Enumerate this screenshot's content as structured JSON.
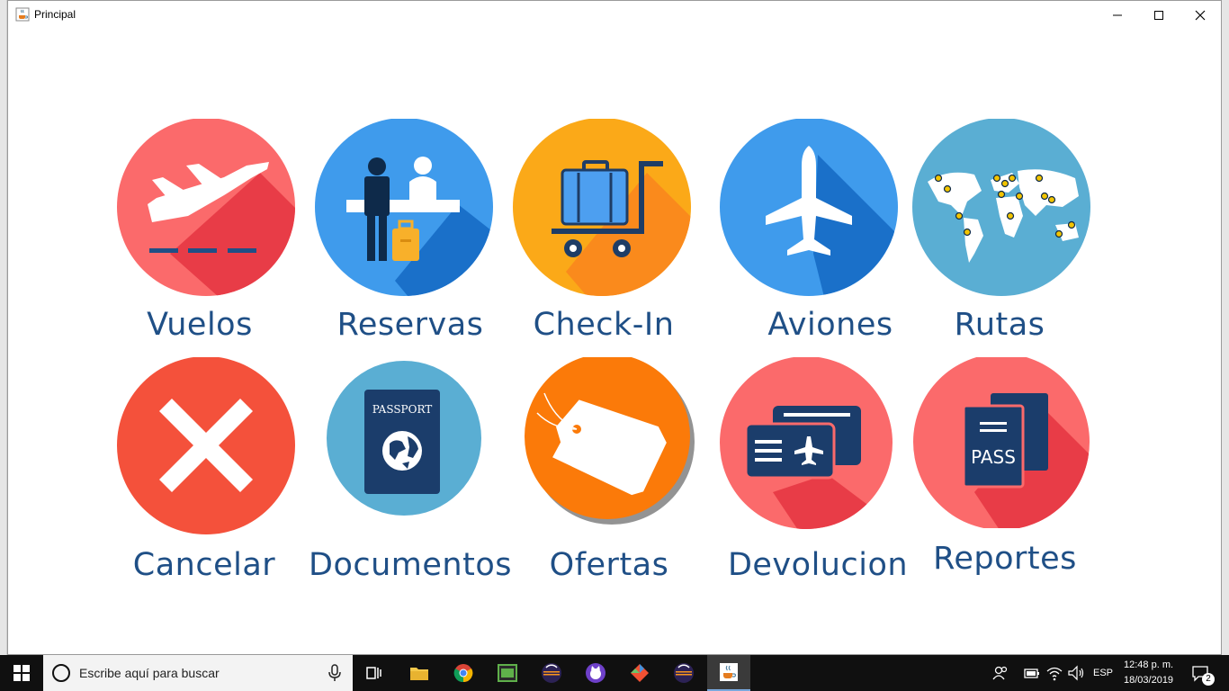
{
  "window": {
    "title": "Principal",
    "icon": "java-cup-icon"
  },
  "tiles": [
    {
      "id": "vuelos",
      "label": "Vuelos",
      "icon": "airplane-takeoff-icon",
      "color": "#f2484d"
    },
    {
      "id": "reservas",
      "label": "Reservas",
      "icon": "reception-desk-icon",
      "color": "#1e86e0"
    },
    {
      "id": "checkin",
      "label": "Check-In",
      "icon": "luggage-cart-icon",
      "color": "#f8a11b"
    },
    {
      "id": "aviones",
      "label": "Aviones",
      "icon": "airplane-icon",
      "color": "#1e86e0"
    },
    {
      "id": "rutas",
      "label": "Rutas",
      "icon": "world-map-icon",
      "color": "#5aaed3"
    },
    {
      "id": "cancelar",
      "label": "Cancelar",
      "icon": "cross-icon",
      "color": "#f4493a"
    },
    {
      "id": "documentos",
      "label": "Documentos",
      "icon": "passport-icon",
      "color": "#5aaed3"
    },
    {
      "id": "ofertas",
      "label": "Ofertas",
      "icon": "price-tag-icon",
      "color": "#fb7a09"
    },
    {
      "id": "devolucion",
      "label": "Devolucion",
      "icon": "tickets-icon",
      "color": "#f2484d"
    },
    {
      "id": "reportes",
      "label": "Reportes",
      "icon": "pass-document-icon",
      "color": "#f2484d"
    }
  ],
  "passport_text": "PASSPORT",
  "pass_text": "PASS",
  "taskbar": {
    "search_placeholder": "Escribe aquí para buscar",
    "language": "ESP",
    "time": "12:48 p. m.",
    "date": "18/03/2019",
    "notifications": "2"
  }
}
